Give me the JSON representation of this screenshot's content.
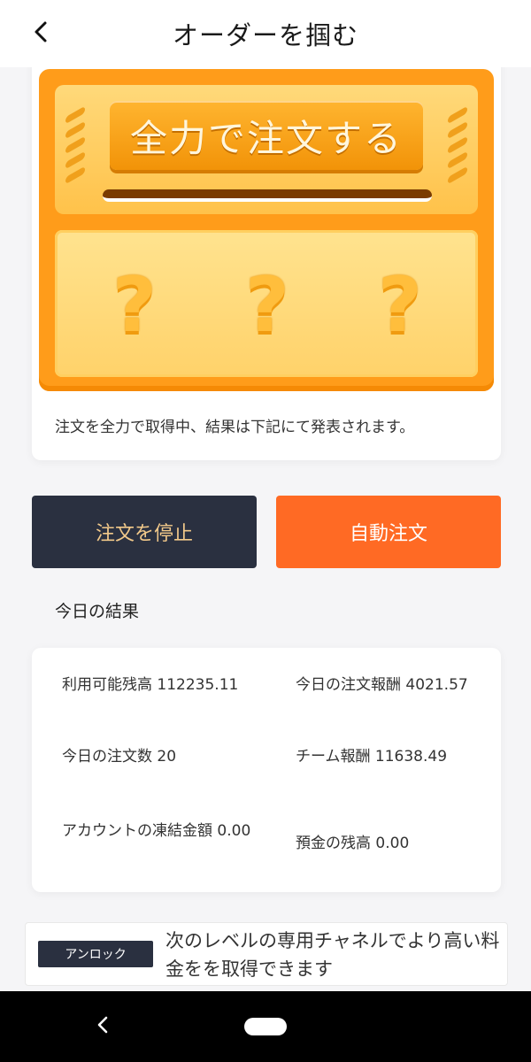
{
  "header": {
    "title": "オーダーを掴む",
    "back_icon": "chevron-left-icon"
  },
  "machine": {
    "button_label": "全力で注文する",
    "question_marks": [
      "?",
      "?",
      "?"
    ],
    "description": "注文を全力で取得中、結果は下記にて発表されます。",
    "colors": {
      "body": "#ff9c1a",
      "button": "#f29308",
      "panel": "#ffe38f"
    }
  },
  "actions": {
    "stop_label": "注文を停止",
    "auto_label": "自動注文",
    "colors": {
      "stop_bg": "#2a3040",
      "stop_text": "#f2c98a",
      "auto_bg": "#ff6a24"
    }
  },
  "results": {
    "title": "今日の結果",
    "items": [
      {
        "label": "利用可能残高 112235.11"
      },
      {
        "label": "今日の注文報酬 4021.57"
      },
      {
        "label": "今日の注文数 20"
      },
      {
        "label": "チーム報酬 11638.49"
      },
      {
        "label": "アカウントの凍結金額 0.00"
      },
      {
        "label": "預金の残高 0.00"
      }
    ]
  },
  "unlock": {
    "badge": "アンロック",
    "text": "次のレベルの専用チャネルでより高い料金をを取得できます"
  },
  "navbar": {
    "back_icon": "nav-back-icon",
    "home_icon": "nav-home-pill-icon"
  }
}
